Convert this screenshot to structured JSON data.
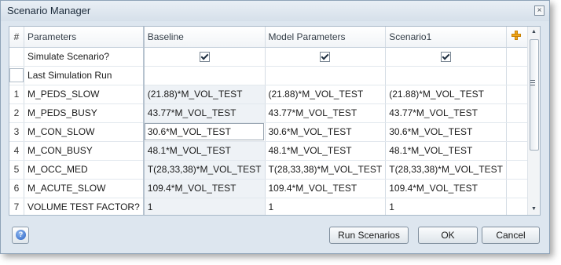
{
  "window": {
    "title": "Scenario Manager",
    "close_glyph": "×"
  },
  "grid": {
    "headers": {
      "num": "#",
      "parameters": "Parameters",
      "baseline": "Baseline",
      "model_parameters": "Model Parameters",
      "scenario1": "Scenario1"
    },
    "special_rows": {
      "simulate": "Simulate Scenario?",
      "last_run": "Last Simulation Run"
    },
    "rows": [
      {
        "num": "1",
        "param": "M_PEDS_SLOW",
        "baseline": "(21.88)*M_VOL_TEST",
        "model": "(21.88)*M_VOL_TEST",
        "scenario1": "(21.88)*M_VOL_TEST"
      },
      {
        "num": "2",
        "param": "M_PEDS_BUSY",
        "baseline": "43.77*M_VOL_TEST",
        "model": "43.77*M_VOL_TEST",
        "scenario1": "43.77*M_VOL_TEST"
      },
      {
        "num": "3",
        "param": "M_CON_SLOW",
        "baseline": "30.6*M_VOL_TEST",
        "model": "30.6*M_VOL_TEST",
        "scenario1": "30.6*M_VOL_TEST"
      },
      {
        "num": "4",
        "param": "M_CON_BUSY",
        "baseline": "48.1*M_VOL_TEST",
        "model": "48.1*M_VOL_TEST",
        "scenario1": "48.1*M_VOL_TEST"
      },
      {
        "num": "5",
        "param": "M_OCC_MED",
        "baseline": "T(28,33,38)*M_VOL_TEST",
        "model": "T(28,33,38)*M_VOL_TEST",
        "scenario1": "T(28,33,38)*M_VOL_TEST"
      },
      {
        "num": "6",
        "param": "M_ACUTE_SLOW",
        "baseline": "109.4*M_VOL_TEST",
        "model": "109.4*M_VOL_TEST",
        "scenario1": "109.4*M_VOL_TEST"
      },
      {
        "num": "7",
        "param": "VOLUME TEST FACTOR?",
        "baseline": "1",
        "model": "1",
        "scenario1": "1"
      }
    ]
  },
  "buttons": {
    "run_scenarios": "Run Scenarios",
    "ok": "OK",
    "cancel": "Cancel"
  },
  "colors": {
    "accent_plus": "#f2a81d",
    "baseline_column_bg": "#eef2f6"
  }
}
